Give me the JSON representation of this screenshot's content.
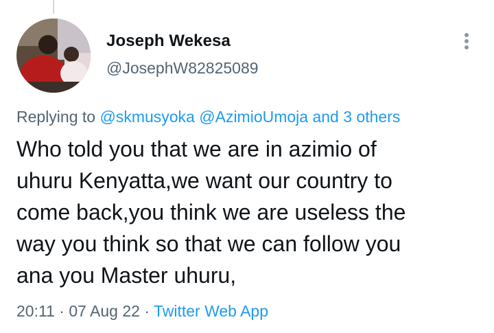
{
  "colors": {
    "text_primary": "#0f1419",
    "text_secondary": "#536471",
    "link": "#1d9bf0"
  },
  "tweet": {
    "author": {
      "display_name": "Joseph Wekesa",
      "handle": "@JosephW82825089",
      "avatar_icon": "profile-photo"
    },
    "more_icon": "vertical-ellipsis-icon",
    "replying_prefix": "Replying to",
    "replying_mentions": [
      "@skmusyoka",
      "@AzimioUmoja"
    ],
    "replying_and": "and",
    "replying_others": "3 others",
    "text_lines": [
      "Who told you that we are in azimio of",
      "uhuru Kenyatta,we want our country to",
      "come back,you think we are useless the",
      "way you think so that we can follow you",
      "ana you Master uhuru,"
    ],
    "time": "20:11",
    "separator": "·",
    "date": "07 Aug 22",
    "source": "Twitter Web App"
  }
}
